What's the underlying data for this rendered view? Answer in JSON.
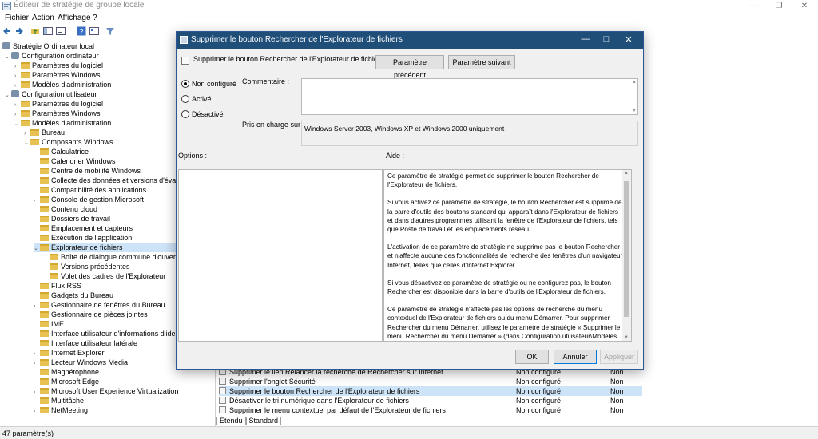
{
  "window": {
    "title": "Éditeur de stratégie de groupe locale",
    "menu": [
      "Fichier",
      "Action",
      "Affichage",
      "?"
    ]
  },
  "tree": {
    "items": [
      {
        "label": "Stratégie Ordinateur local"
      },
      {
        "label": "Configuration ordinateur"
      },
      {
        "label": "Paramètres du logiciel"
      },
      {
        "label": "Paramètres Windows"
      },
      {
        "label": "Modèles d'administration"
      },
      {
        "label": "Configuration utilisateur"
      },
      {
        "label": "Paramètres du logiciel"
      },
      {
        "label": "Paramètres Windows"
      },
      {
        "label": "Modèles d'administration"
      },
      {
        "label": "Bureau"
      },
      {
        "label": "Composants Windows"
      },
      {
        "label": "Calculatrice"
      },
      {
        "label": "Calendrier Windows"
      },
      {
        "label": "Centre de mobilité Windows"
      },
      {
        "label": "Collecte des données et versions d'évaluation"
      },
      {
        "label": "Compatibilité des applications"
      },
      {
        "label": "Console de gestion Microsoft"
      },
      {
        "label": "Contenu cloud"
      },
      {
        "label": "Dossiers de travail"
      },
      {
        "label": "Emplacement et capteurs"
      },
      {
        "label": "Exécution de l'application"
      },
      {
        "label": "Explorateur de fichiers"
      },
      {
        "label": "Boîte de dialogue commune d'ouverture"
      },
      {
        "label": "Versions précédentes"
      },
      {
        "label": "Volet des cadres de l'Explorateur"
      },
      {
        "label": "Flux RSS"
      },
      {
        "label": "Gadgets du Bureau"
      },
      {
        "label": "Gestionnaire de fenêtres du Bureau"
      },
      {
        "label": "Gestionnaire de pièces jointes"
      },
      {
        "label": "IME"
      },
      {
        "label": "Interface utilisateur d'informations d'identification"
      },
      {
        "label": "Interface utilisateur latérale"
      },
      {
        "label": "Internet Explorer"
      },
      {
        "label": "Lecteur Windows Media"
      },
      {
        "label": "Magnétophone"
      },
      {
        "label": "Microsoft Edge"
      },
      {
        "label": "Microsoft User Experience Virtualization"
      },
      {
        "label": "Multitâche"
      },
      {
        "label": "NetMeeting"
      }
    ]
  },
  "list": {
    "rows": [
      {
        "name": "Supprimer le lien Relancer la recherche de Rechercher sur Internet",
        "state": "Non configuré",
        "comment": "Non"
      },
      {
        "name": "Supprimer l'onglet Sécurité",
        "state": "Non configuré",
        "comment": "Non"
      },
      {
        "name": "Supprimer le bouton Rechercher de l'Explorateur de fichiers",
        "state": "Non configuré",
        "comment": "Non"
      },
      {
        "name": "Désactiver le tri numérique dans l'Explorateur de fichiers",
        "state": "Non configuré",
        "comment": "Non"
      },
      {
        "name": "Supprimer le menu contextuel par défaut de l'Explorateur de fichiers",
        "state": "Non configuré",
        "comment": "Non"
      }
    ],
    "tabs": [
      "Étendu",
      "Standard"
    ]
  },
  "status": "47 paramètre(s)",
  "dialog": {
    "title": "Supprimer le bouton Rechercher de l'Explorateur de fichiers",
    "header": "Supprimer le bouton Rechercher de l'Explorateur de fichiers",
    "prev_button": "Paramètre précédent",
    "next_button": "Paramètre suivant",
    "radios": [
      "Non configuré",
      "Activé",
      "Désactivé"
    ],
    "selected_radio": "Non configuré",
    "comment_label": "Commentaire :",
    "supported_label": "Pris en charge sur :",
    "supported_value": "Windows Server 2003, Windows XP et Windows 2000 uniquement",
    "options_label": "Options :",
    "help_label": "Aide :",
    "help_paragraphs": [
      "Ce paramètre de stratégie permet de supprimer le bouton Rechercher de l'Explorateur de fichiers.",
      "Si vous activez ce paramètre de stratégie, le bouton Rechercher est supprimé de la barre d'outils des boutons standard qui apparaît dans l'Explorateur de fichiers et dans d'autres programmes utilisant la fenêtre de l'Explorateur de fichiers, tels que Poste de travail et les emplacements réseau.",
      "L'activation de ce paramètre de stratégie ne supprime pas le bouton Rechercher et n'affecte aucune des fonctionnalités de recherche des fenêtres d'un navigateur Internet, telles que celles d'Internet Explorer.",
      "Si vous désactivez ce paramètre de stratégie ou ne configurez pas, le bouton Rechercher est disponible dans la barre d'outils de l'Explorateur de fichiers.",
      "Ce paramètre de stratégie n'affecte pas les options de recherche du menu contextuel de l'Explorateur de fichiers ou du menu Démarrer. Pour supprimer Rechercher du menu Démarrer, utilisez le paramètre de stratégie « Supprimer le menu Rechercher du menu Démarrer » (dans Configuration utilisateur\\Modèles d'administration\\Menu Démarrer et barre des tâches). Pour masquer tous les menus contextuels, utilisez le paramètre de"
    ],
    "ok_button": "OK",
    "cancel_button": "Annuler",
    "apply_button": "Appliquer"
  }
}
